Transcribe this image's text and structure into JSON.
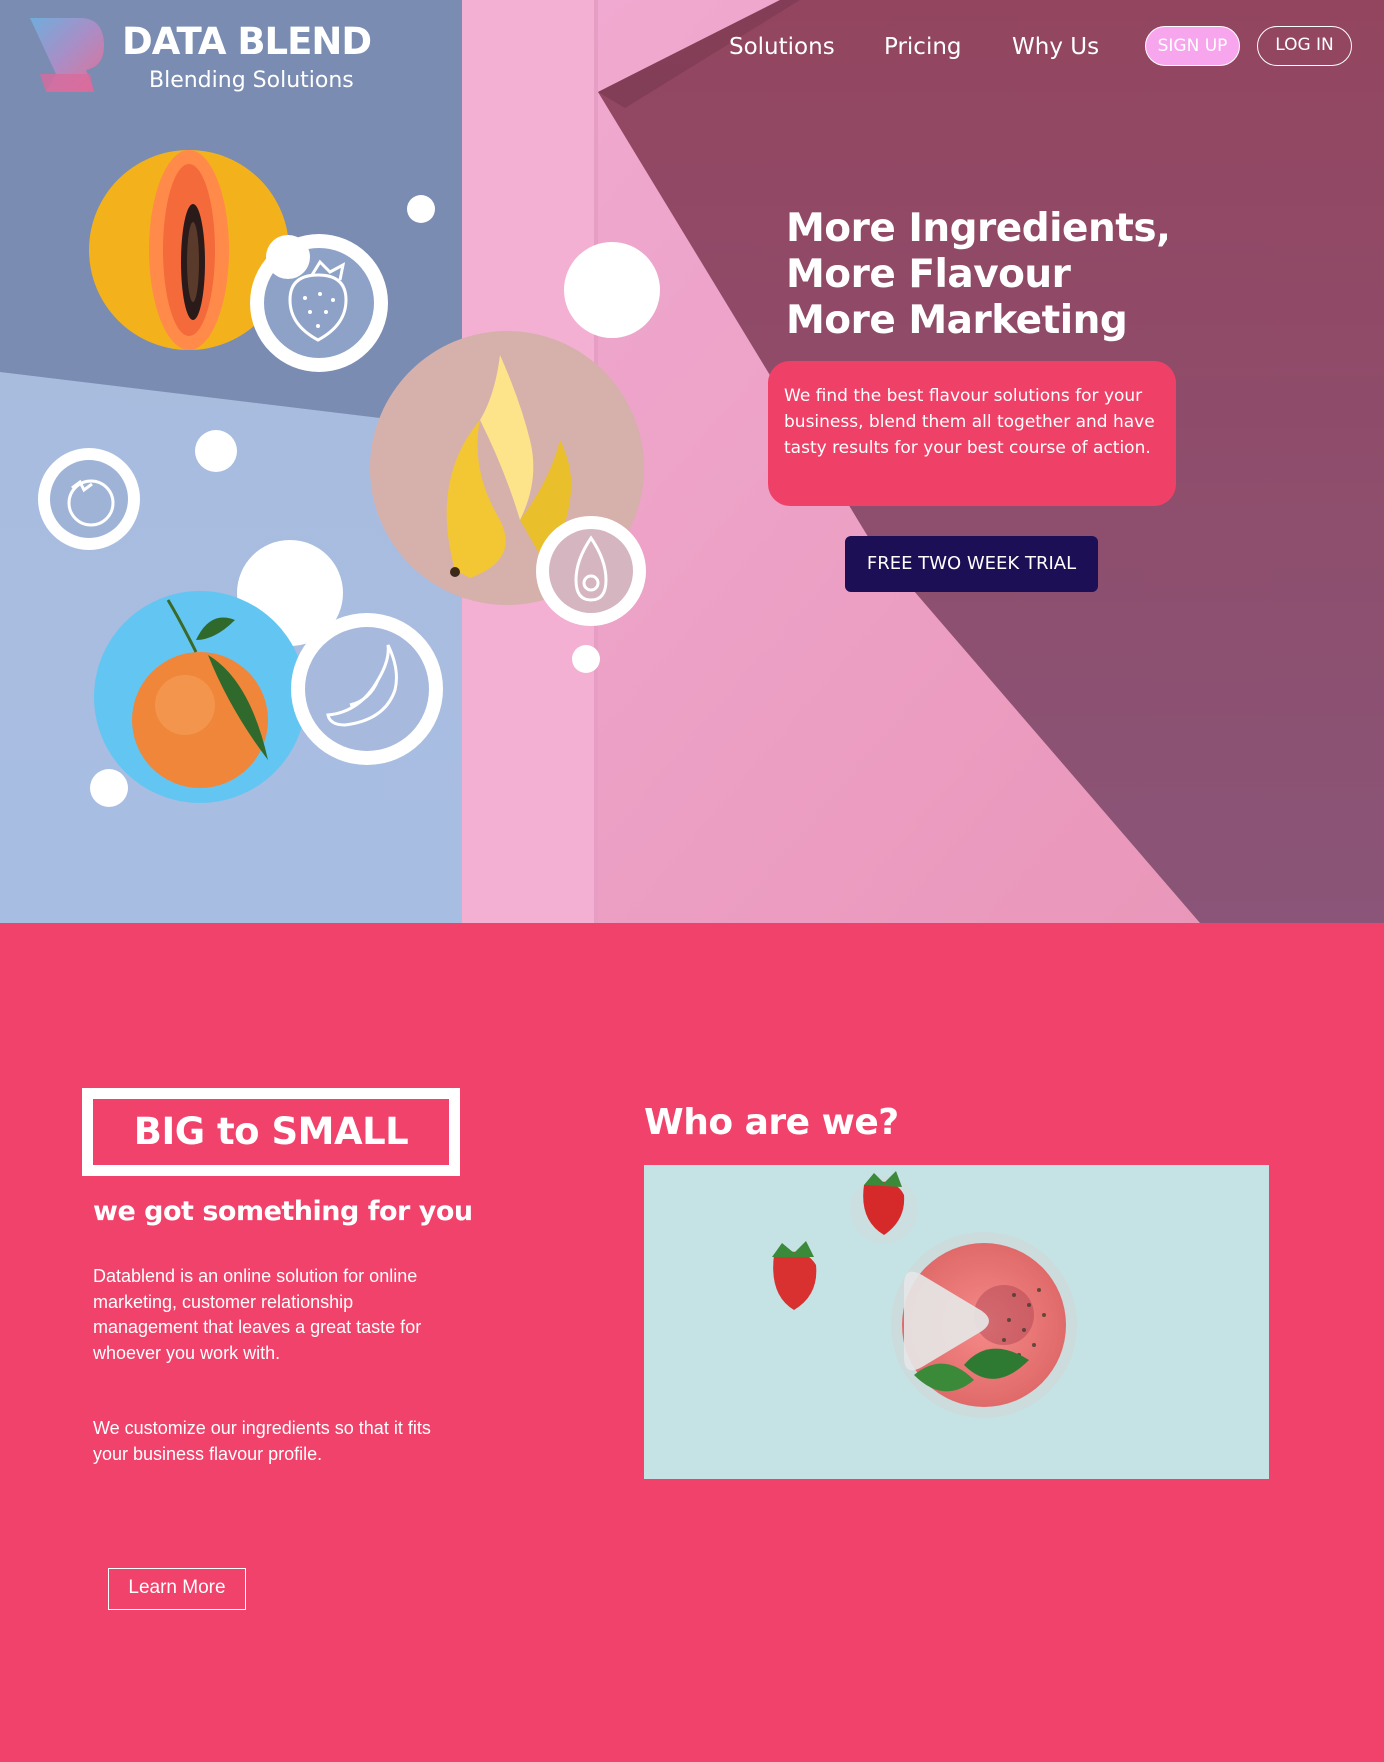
{
  "brand": {
    "name": "DATA BLEND",
    "tagline": "Blending Solutions"
  },
  "nav": {
    "links": [
      "Solutions",
      "Pricing",
      "Why Us"
    ],
    "signup_label": "SIGN UP",
    "login_label": "LOG IN"
  },
  "hero": {
    "headline": [
      "More Ingredients,",
      "More Flavour",
      "More Marketing"
    ],
    "description": "We find the best flavour solutions for your business, blend them all together and have tasty results for your best course of action.",
    "cta_label": "FREE TWO WEEK TRIAL",
    "fruit_icons": [
      "strawberry-icon",
      "tomato-icon",
      "avocado-icon",
      "banana-icon"
    ]
  },
  "about": {
    "badge": "BIG to SMALL",
    "subheading": "we got something for you",
    "paragraph1": "Datablend is an online solution for online marketing, customer relationship management that leaves a great taste for whoever you work with.",
    "paragraph2": "We customize our ingredients so that it fits your business flavour profile.",
    "learn_more_label": "Learn More"
  },
  "who": {
    "heading": "Who are we?",
    "video_icon": "play-icon"
  },
  "colors": {
    "accent_pink": "#f0426a",
    "cta_navy": "#1c0f56",
    "signup_pink": "#f7a6ee"
  }
}
